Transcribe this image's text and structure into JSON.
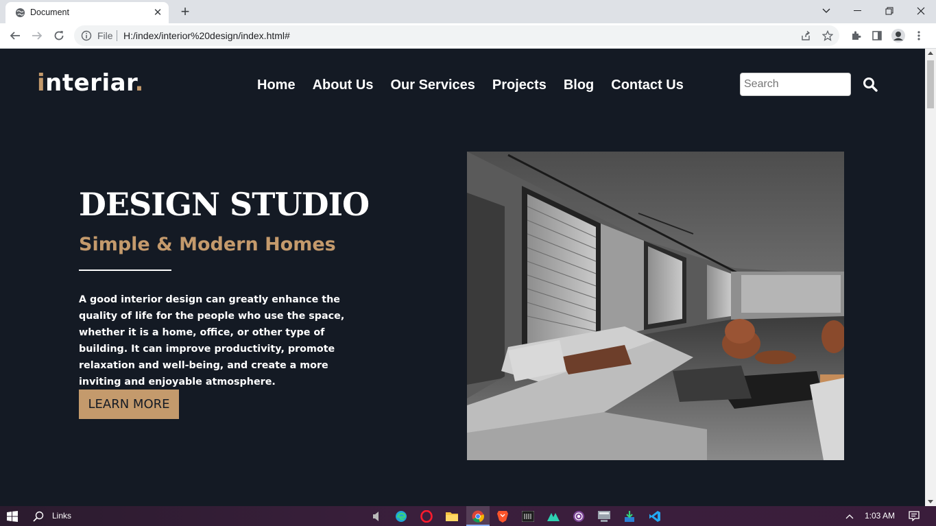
{
  "browser": {
    "tab_title": "Document",
    "omnibox": {
      "scheme_label": "File",
      "url": "H:/index/interior%20design/index.html#"
    }
  },
  "site": {
    "logo_first": "i",
    "logo_rest": "nteriar",
    "logo_dot": ".",
    "nav": {
      "home": "Home",
      "about": "About Us",
      "services": "Our Services",
      "projects": "Projects",
      "blog": "Blog",
      "contact": "Contact Us"
    },
    "search_placeholder": "Search",
    "hero": {
      "title": "DESIGN STUDIO",
      "subtitle": "Simple & Modern Homes",
      "text": "A good interior design can greatly enhance the quality of life for the people who use the space, whether it is a home, office, or other type of building. It can improve productivity, promote relaxation and well-being, and create a more inviting and enjoyable atmosphere.",
      "button": "LEARN MORE"
    }
  },
  "taskbar": {
    "search_label": "Links",
    "time": "1:03 AM"
  },
  "colors": {
    "background": "#141a24",
    "accent": "#c49a6c",
    "text": "#ffffff"
  }
}
